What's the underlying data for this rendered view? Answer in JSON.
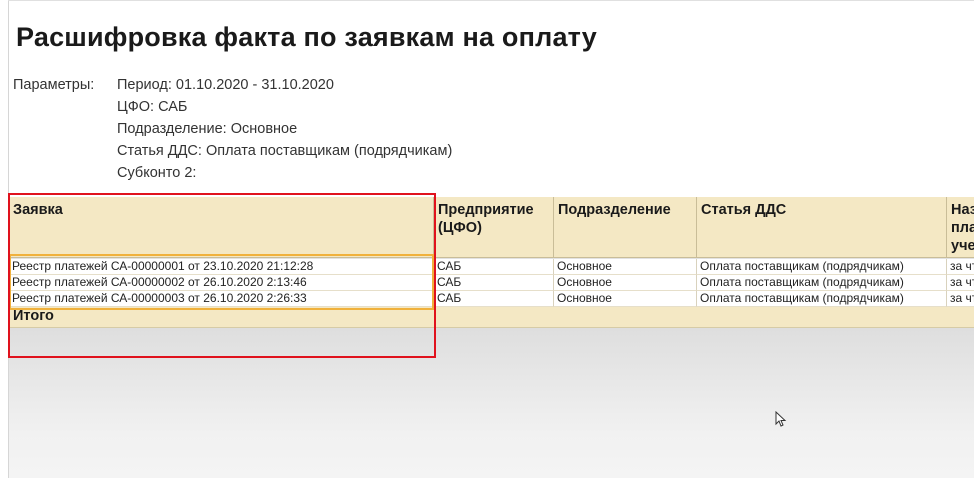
{
  "report": {
    "title": "Расшифровка факта по заявкам на оплату",
    "parameters_label": "Параметры:",
    "parameters": {
      "period": "Период: 01.10.2020 - 31.10.2020",
      "cfo": "ЦФО: САБ",
      "division": "Подразделение: Основное",
      "dds_item": "Статья ДДС: Оплата поставщикам (подрядчикам)",
      "subconto2": "Субконто 2:"
    }
  },
  "table": {
    "headers": [
      "Заявка",
      "Предприятие (ЦФО)",
      "Подразделение",
      "Статья ДДС",
      "Назначение платежа учет"
    ],
    "header_display": [
      "Заявка",
      "Предприятие\n(ЦФО)",
      "Подразделение",
      "Статья ДДС",
      "Наз\nпла\nуче"
    ],
    "rows": [
      [
        "Реестр платежей СА-00000001 от 23.10.2020 21:12:28",
        "САБ",
        "Основное",
        "Оплата поставщикам (подрядчикам)",
        "за чт"
      ],
      [
        "Реестр платежей СА-00000002 от 26.10.2020 2:13:46",
        "САБ",
        "Основное",
        "Оплата поставщикам (подрядчикам)",
        "за чт"
      ],
      [
        "Реестр платежей СА-00000003 от 26.10.2020 2:26:33",
        "САБ",
        "Основное",
        "Оплата поставщикам (подрядчикам)",
        "за чт"
      ]
    ],
    "total_label": "Итого"
  },
  "colors": {
    "header_bg": "#f4e8c4",
    "highlight_red": "#e0121d",
    "highlight_orange": "#f0b13c"
  },
  "icons": {
    "cursor": "mouse-pointer-icon"
  }
}
